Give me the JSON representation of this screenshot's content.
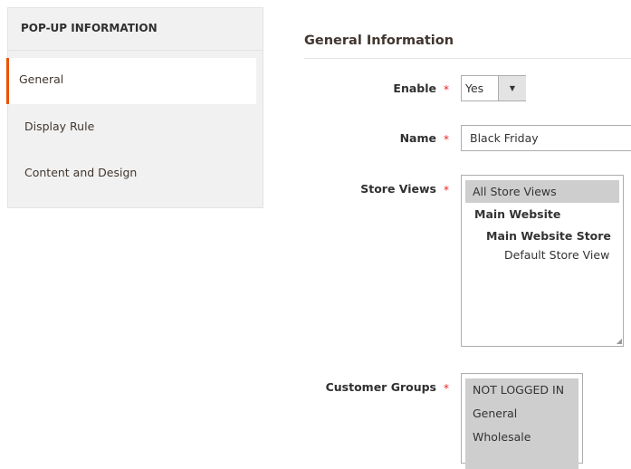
{
  "sidebar": {
    "heading": "POP-UP INFORMATION",
    "items": [
      {
        "label": "General",
        "active": true
      },
      {
        "label": "Display Rule"
      },
      {
        "label": "Content and Design"
      }
    ]
  },
  "accent_color": "#eb5202",
  "main": {
    "title": "General Information",
    "fields": {
      "enable": {
        "label": "Enable",
        "value": "Yes"
      },
      "name": {
        "label": "Name",
        "value": "Black Friday"
      },
      "store_views": {
        "label": "Store Views",
        "options": [
          "All Store Views",
          "Main Website",
          "Main Website Store",
          "Default Store View"
        ]
      },
      "customer_groups": {
        "label": "Customer Groups",
        "options": [
          "NOT LOGGED IN",
          "General",
          "Wholesale"
        ]
      }
    },
    "required_marker": "*",
    "dropdown_icon": "▼"
  }
}
